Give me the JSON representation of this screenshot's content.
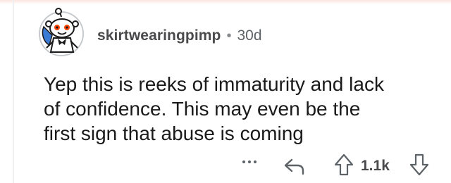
{
  "comment": {
    "username": "skirtwearingpimp",
    "separator": "•",
    "age": "30d",
    "body_lines": [
      "Yep this is reeks of immaturity and lack",
      "of confidence. This may even be the",
      "first sign that abuse is coming"
    ]
  },
  "actions": {
    "more_label": "...",
    "score": "1.1k"
  },
  "icons": {
    "avatar": "snoo-avatar-icon",
    "more": "more-options-icon",
    "reply": "reply-arrow-icon",
    "upvote": "upvote-arrow-icon",
    "downvote": "downvote-arrow-icon"
  },
  "colors": {
    "text": "#1a1a1b",
    "meta": "#4a4a4c",
    "muted": "#878a8c",
    "avatar_accent": "#ff4500",
    "avatar_blue": "#3a7bd5"
  }
}
